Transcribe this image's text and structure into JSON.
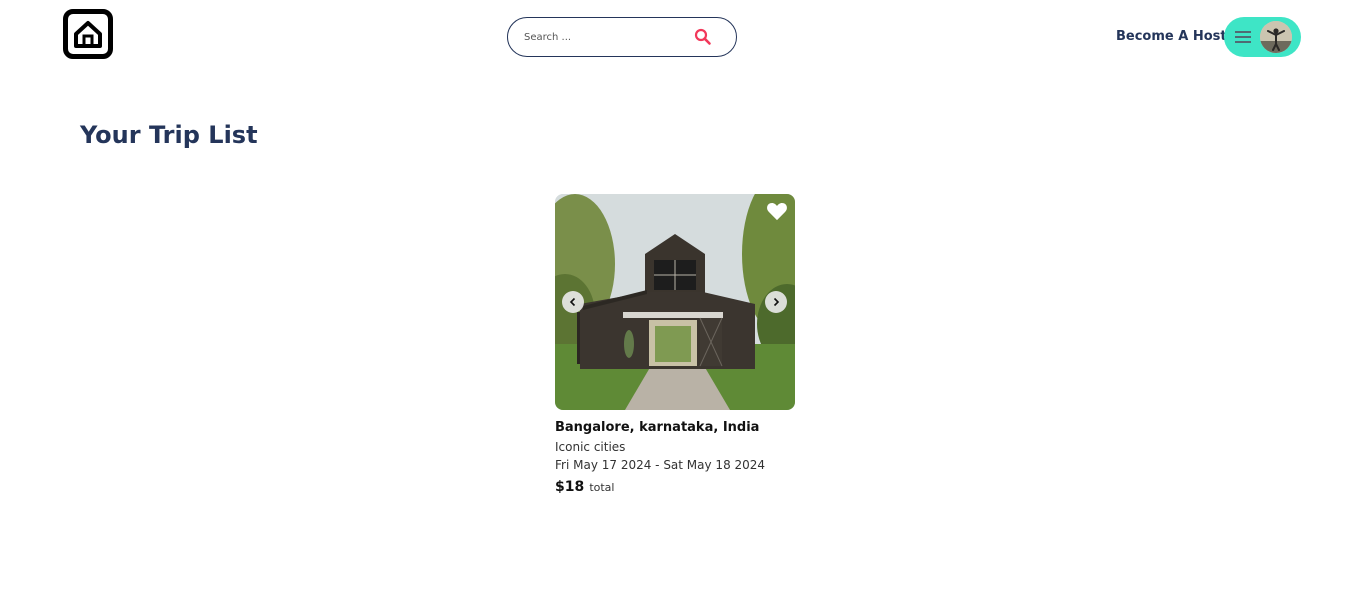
{
  "navbar": {
    "search": {
      "placeholder": "Search ..."
    },
    "host_link": "Become A Host"
  },
  "page": {
    "title": "Your Trip List"
  },
  "trips": [
    {
      "location": "Bangalore, karnataka, India",
      "category": "Iconic cities",
      "dates": "Fri May 17 2024 - Sat May 18 2024",
      "price": "$18",
      "price_suffix": "total"
    }
  ],
  "colors": {
    "brand_navy": "#24355a",
    "accent_teal": "#3ee5c6",
    "search_icon": "#f2385a"
  },
  "icons": {
    "logo": "house-icon",
    "search": "search-icon",
    "menu": "menu-icon",
    "favorite": "heart-icon",
    "prev": "chevron-left-icon",
    "next": "chevron-right-icon"
  }
}
